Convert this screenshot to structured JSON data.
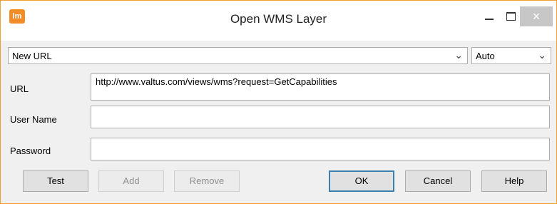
{
  "window": {
    "title": "Open WMS Layer",
    "app_icon_text": "lm",
    "close_symbol": "×"
  },
  "form": {
    "url_select": {
      "value": "New URL"
    },
    "auto_select": {
      "value": "Auto"
    },
    "url": {
      "label": "URL",
      "value": "http://www.valtus.com/views/wms?request=GetCapabilities"
    },
    "username": {
      "label": "User Name",
      "value": ""
    },
    "password": {
      "label": "Password",
      "value": ""
    }
  },
  "buttons": {
    "test": "Test",
    "add": "Add",
    "remove": "Remove",
    "ok": "OK",
    "cancel": "Cancel",
    "help": "Help"
  },
  "colors": {
    "window_border": "#f0a030",
    "app_icon": "#f28c28",
    "default_button_border": "#3c7fb1"
  }
}
